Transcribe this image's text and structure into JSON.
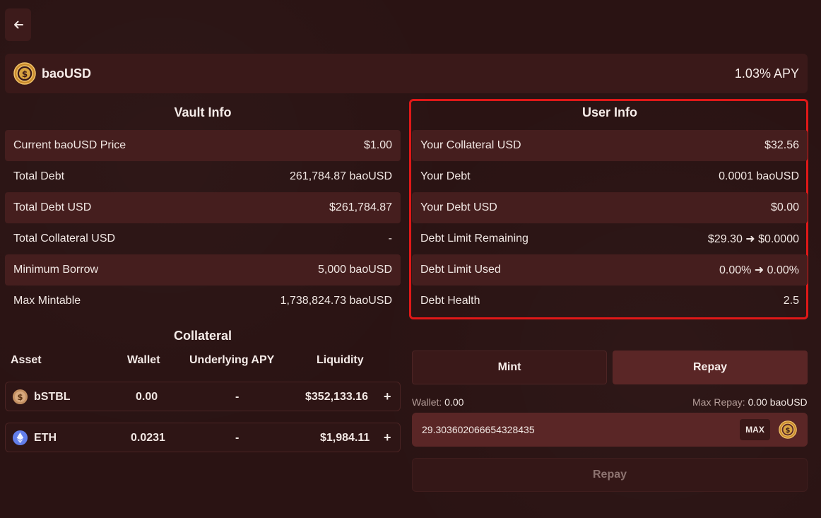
{
  "header": {
    "title": "baoUSD",
    "apy": "1.03% APY"
  },
  "vault_info": {
    "title": "Vault Info",
    "rows": [
      {
        "label": "Current baoUSD Price",
        "value": "$1.00"
      },
      {
        "label": "Total Debt",
        "value": "261,784.87 baoUSD"
      },
      {
        "label": "Total Debt USD",
        "value": "$261,784.87"
      },
      {
        "label": "Total Collateral USD",
        "value": "-"
      },
      {
        "label": "Minimum Borrow",
        "value": "5,000 baoUSD"
      },
      {
        "label": "Max Mintable",
        "value": "1,738,824.73 baoUSD"
      }
    ]
  },
  "user_info": {
    "title": "User Info",
    "rows": [
      {
        "label": "Your Collateral USD",
        "value": "$32.56"
      },
      {
        "label": "Your Debt",
        "value": "0.0001 baoUSD"
      },
      {
        "label": "Your Debt USD",
        "value": "$0.00"
      },
      {
        "label": "Debt Limit Remaining",
        "value": "$29.30 ➜ $0.0000"
      },
      {
        "label": "Debt Limit Used",
        "value": "0.00% ➜ 0.00%"
      },
      {
        "label": "Debt Health",
        "value": "2.5"
      }
    ]
  },
  "collateral": {
    "title": "Collateral",
    "headers": {
      "asset": "Asset",
      "wallet": "Wallet",
      "apy": "Underlying APY",
      "liquidity": "Liquidity"
    },
    "rows": [
      {
        "asset": "bSTBL",
        "wallet": "0.00",
        "apy": "-",
        "liquidity": "$352,133.16",
        "add": "+"
      },
      {
        "asset": "ETH",
        "wallet": "0.0231",
        "apy": "-",
        "liquidity": "$1,984.11",
        "add": "+"
      }
    ]
  },
  "action": {
    "tabs": [
      "Mint",
      "Repay"
    ],
    "active_tab": "Repay",
    "wallet_label": "Wallet:",
    "wallet_value": "0.00",
    "max_repay_label": "Max Repay:",
    "max_repay_value": "0.00 baoUSD",
    "input_value": "29.303602066654328435",
    "max_label": "MAX",
    "submit_label": "Repay"
  },
  "colors": {
    "background": "#2a1313",
    "highlight_border": "#e01818",
    "coin_gold": "#d9a441",
    "eth_blue": "#627eea"
  }
}
